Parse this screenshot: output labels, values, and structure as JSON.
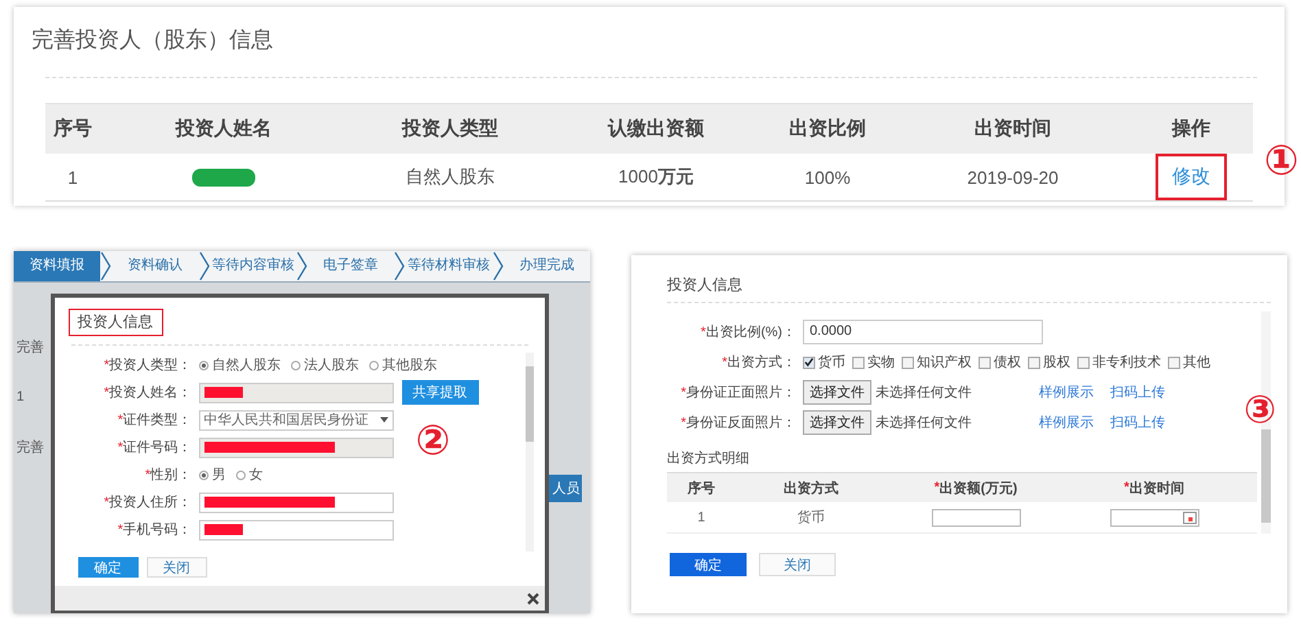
{
  "panel_1": {
    "title": "完善投资人（股东）信息",
    "columns": [
      "序号",
      "投资人姓名",
      "投资人类型",
      "认缴出资额",
      "出资比例",
      "出资时间",
      "操作"
    ],
    "rows": [
      {
        "cells": [
          {
            "kind": "text",
            "text": "1"
          },
          {
            "kind": "redaction",
            "color": "#1ea84a"
          },
          {
            "kind": "text",
            "text": "自然人股东"
          },
          {
            "kind": "text",
            "text": "1000**万元**"
          },
          {
            "kind": "text",
            "text": "100%"
          },
          {
            "kind": "text",
            "text": "2019-09-20"
          },
          {
            "kind": "link",
            "text": "修改",
            "highlighted": true
          }
        ]
      }
    ],
    "marker": "①"
  },
  "panel_2": {
    "steps": [
      {
        "label": "资料填报",
        "selected": true
      },
      {
        "label": "资料确认",
        "selected": false
      },
      {
        "label": "等待内容审核",
        "selected": false
      },
      {
        "label": "电子签章",
        "selected": false
      },
      {
        "label": "等待材料审核",
        "selected": false
      },
      {
        "label": "办理完成",
        "selected": false
      }
    ],
    "page_fragments": [
      "完善",
      "1",
      "完善"
    ],
    "side_button": "人员",
    "dialog": {
      "title": "投资人信息",
      "title_highlighted": true,
      "fields": [
        {
          "kind": "radio",
          "mark": "*",
          "label": "投资人类型：",
          "options": [
            {
              "label": "自然人股东",
              "selected": true
            },
            {
              "label": "法人股东",
              "selected": false
            },
            {
              "label": "其他股东",
              "selected": false
            }
          ]
        },
        {
          "kind": "input",
          "mark": "*",
          "label": "投资人姓名：",
          "readonly": true,
          "redaction": {
            "color": "#ff1030"
          },
          "button": "共享提取"
        },
        {
          "kind": "select",
          "mark": "*",
          "label": "证件类型：",
          "value": "中华人民共和国居民身份证"
        },
        {
          "kind": "input",
          "mark": "*",
          "label": "证件号码：",
          "readonly": true,
          "redaction": {
            "color": "#ff1030"
          }
        },
        {
          "kind": "radio",
          "mark": "*",
          "label": "性别：",
          "options": [
            {
              "label": "男",
              "selected": true
            },
            {
              "label": "女",
              "selected": false
            }
          ]
        },
        {
          "kind": "input",
          "mark": "*",
          "label": "投资人住所：",
          "readonly": false,
          "redaction": {
            "color": "#ff1030"
          }
        },
        {
          "kind": "input",
          "mark": "*",
          "label": "手机号码：",
          "readonly": false,
          "redaction": {
            "color": "#ff1030"
          }
        }
      ],
      "buttons": [
        {
          "label": "确定",
          "primary": true
        },
        {
          "label": "关闭",
          "primary": false
        }
      ]
    },
    "marker": "②"
  },
  "panel_3": {
    "title": "投资人信息",
    "fields": [
      {
        "kind": "input",
        "mark": "*",
        "label": "出资比例(%)：",
        "value": "0.0000"
      },
      {
        "kind": "checkboxes",
        "mark": "*",
        "label": "出资方式：",
        "options": [
          {
            "label": "货币",
            "checked": true
          },
          {
            "label": "实物",
            "checked": false
          },
          {
            "label": "知识产权",
            "checked": false
          },
          {
            "label": "债权",
            "checked": false
          },
          {
            "label": "股权",
            "checked": false
          },
          {
            "label": "非专利技术",
            "checked": false
          },
          {
            "label": "其他",
            "checked": false
          }
        ]
      },
      {
        "kind": "file",
        "mark": "*",
        "label": "身份证正面照片：",
        "button": "选择文件",
        "status": "未选择任何文件",
        "links": [
          "样例展示",
          "扫码上传"
        ]
      },
      {
        "kind": "file",
        "mark": "*",
        "label": "身份证反面照片：",
        "button": "选择文件",
        "status": "未选择任何文件",
        "links": [
          "样例展示",
          "扫码上传"
        ]
      }
    ],
    "section": "出资方式明细",
    "table": {
      "columns": [
        {
          "label": "序号"
        },
        {
          "label": "出资方式"
        },
        {
          "mark": "*",
          "label": "出资额(万元)"
        },
        {
          "mark": "*",
          "label": "出资时间"
        }
      ],
      "rows": [
        {
          "cells": [
            {
              "kind": "text",
              "text": "1"
            },
            {
              "kind": "text",
              "text": "货币"
            },
            {
              "kind": "input"
            },
            {
              "kind": "date"
            }
          ]
        }
      ]
    },
    "buttons": [
      {
        "label": "确定",
        "primary": true
      },
      {
        "label": "关闭",
        "primary": false
      }
    ],
    "marker": "③"
  }
}
